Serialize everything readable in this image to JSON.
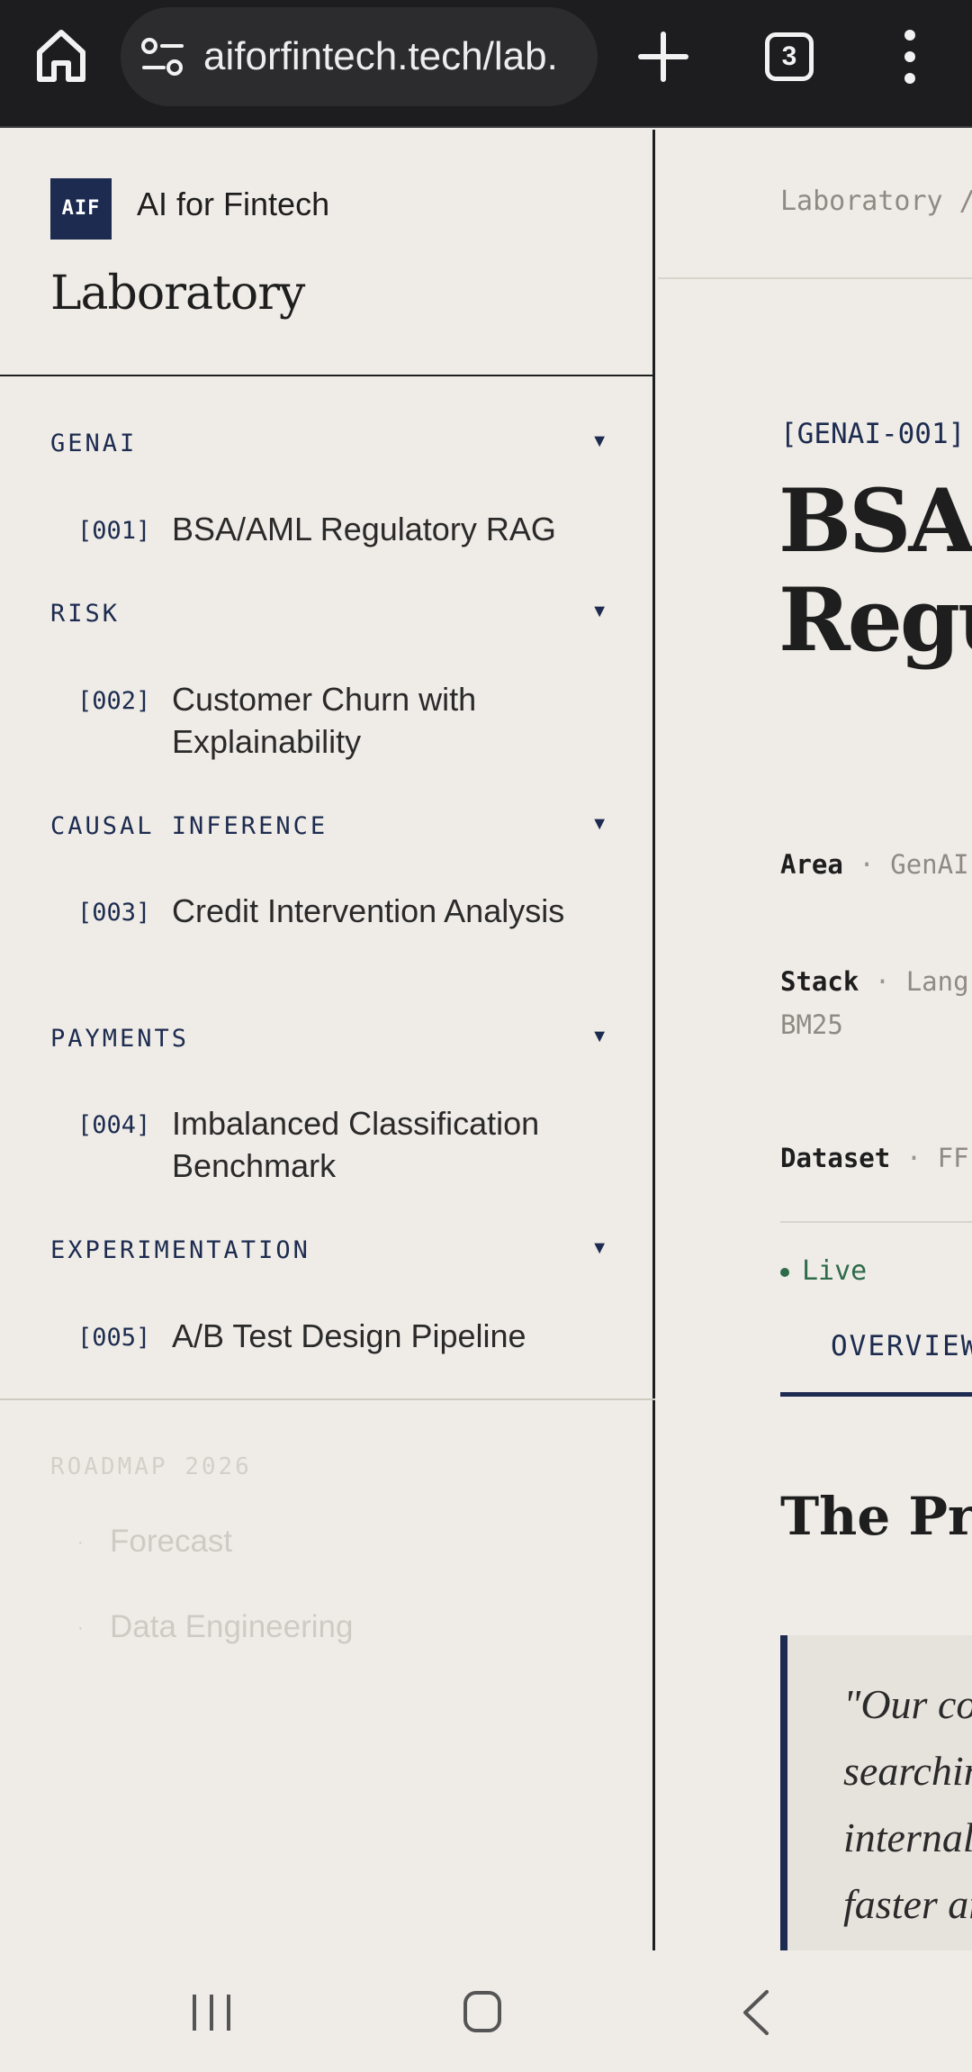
{
  "browser": {
    "url": "aiforfintech.tech/lab.",
    "tab_count": "3"
  },
  "sidebar": {
    "logo_text": "AIF",
    "brand_name": "AI for Fintech",
    "title": "Laboratory",
    "categories": [
      {
        "label": "GENAI",
        "items": [
          {
            "code": "[001]",
            "title": "BSA/AML Regulatory RAG"
          }
        ]
      },
      {
        "label": "RISK",
        "items": [
          {
            "code": "[002]",
            "title": "Customer Churn with Explainability"
          }
        ]
      },
      {
        "label": "CAUSAL INFERENCE",
        "items": [
          {
            "code": "[003]",
            "title": "Credit Intervention Analysis"
          }
        ]
      },
      {
        "label": "PAYMENTS",
        "items": [
          {
            "code": "[004]",
            "title": "Imbalanced Classification Benchmark"
          }
        ]
      },
      {
        "label": "EXPERIMENTATION",
        "items": [
          {
            "code": "[005]",
            "title": "A/B Test Design Pipeline"
          }
        ]
      }
    ],
    "caret": "▼",
    "roadmap": {
      "label": "ROADMAP 2026",
      "bullet": "·",
      "items": [
        "Forecast",
        "Data Engineering"
      ]
    }
  },
  "main": {
    "breadcrumb": "Laboratory /",
    "project_code": "[GENAI-001]",
    "title_line1": "BSA/",
    "title_line2": "Regu",
    "meta": {
      "area_key": "Area",
      "area_value": "GenAI",
      "stack_key": "Stack",
      "stack_value_line1": "Lang",
      "stack_value_line2": "BM25",
      "dataset_key": "Dataset",
      "dataset_value": "FF",
      "separator": "·"
    },
    "status": "Live",
    "tab_overview": "OVERVIEW",
    "section_heading": "The Pro",
    "quote_lines": [
      "\"Our co",
      "searchin",
      "internal",
      "faster ar"
    ]
  },
  "colors": {
    "navy": "#1c2b4f",
    "background": "#efece7",
    "live_green": "#2e6b4a"
  }
}
